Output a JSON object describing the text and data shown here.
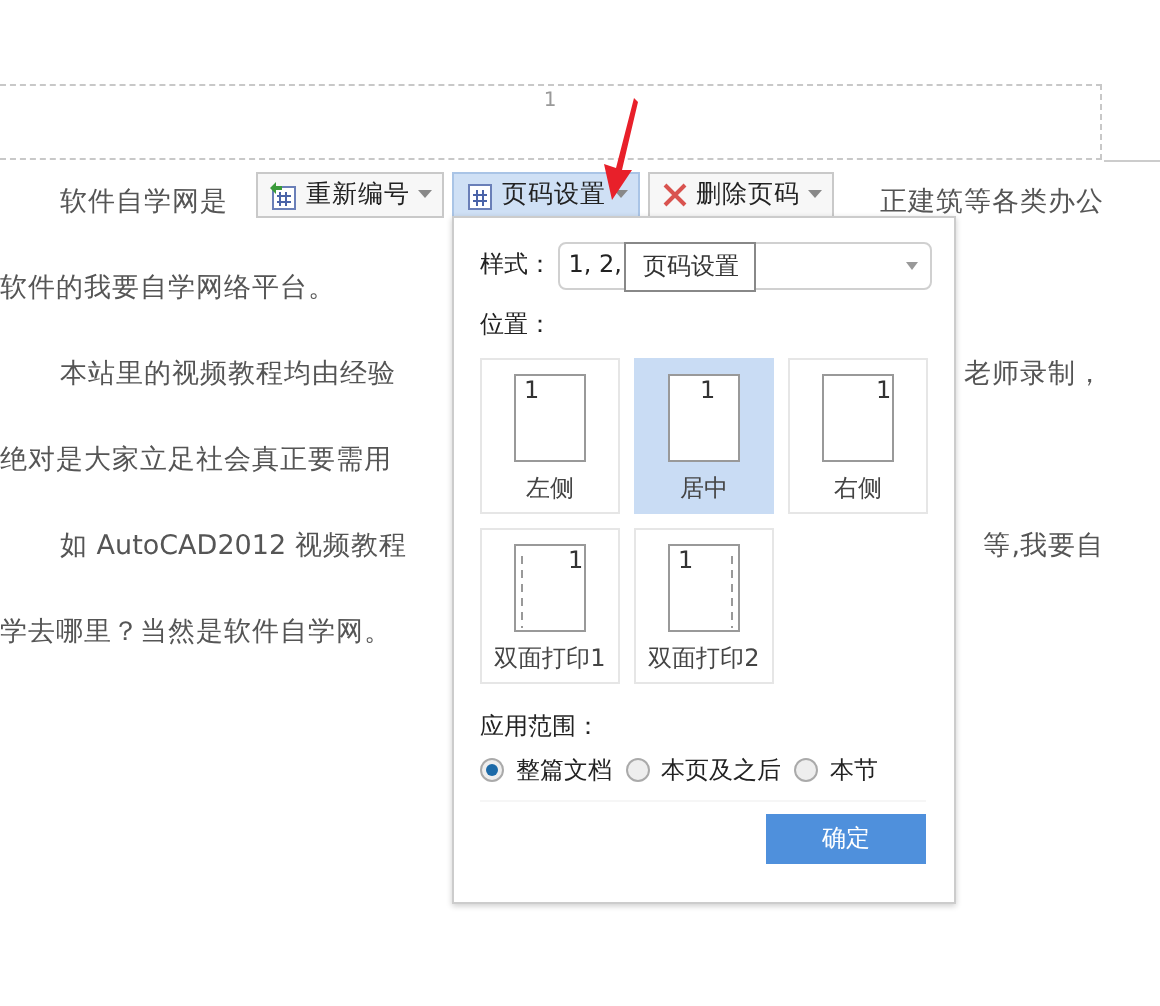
{
  "header": {
    "page_number": "1"
  },
  "document": {
    "lines": [
      {
        "indent": true,
        "left": "软件自学网是",
        "right": "正建筑等各类办公"
      },
      {
        "indent": false,
        "left": "软件的我要自学网络平台。"
      },
      {
        "indent": true,
        "left": "本站里的视频教程均由经验",
        "right": "老师录制，"
      },
      {
        "indent": false,
        "left": "绝对是大家立足社会真正要需用"
      },
      {
        "indent": true,
        "left": "如 AutoCAD2012 视频教程",
        "right": "等,我要自"
      },
      {
        "indent": false,
        "left": "学去哪里？当然是软件自学网。"
      }
    ]
  },
  "toolbar": [
    {
      "kind": "renumber",
      "label": "重新编号",
      "selected": false
    },
    {
      "kind": "settings",
      "label": "页码设置",
      "selected": true
    },
    {
      "kind": "delete",
      "label": "删除页码",
      "selected": false
    }
  ],
  "popup": {
    "style_label": "样式：",
    "style_value": "1, 2,",
    "tooltip": "页码设置",
    "position_label": "位置：",
    "positions": [
      {
        "kind": "left",
        "label": "左侧",
        "number": "1",
        "selected": false
      },
      {
        "kind": "center",
        "label": "居中",
        "number": "1",
        "selected": true
      },
      {
        "kind": "right",
        "label": "右侧",
        "number": "1",
        "selected": false
      },
      {
        "kind": "duplex1",
        "label": "双面打印1",
        "number": "1",
        "selected": false
      },
      {
        "kind": "duplex2",
        "label": "双面打印2",
        "number": "1",
        "selected": false
      }
    ],
    "scope_label": "应用范围：",
    "scopes": [
      {
        "label": "整篇文档",
        "selected": true
      },
      {
        "label": "本页及之后",
        "selected": false
      },
      {
        "label": "本节",
        "selected": false
      }
    ],
    "ok_button": "确定"
  }
}
